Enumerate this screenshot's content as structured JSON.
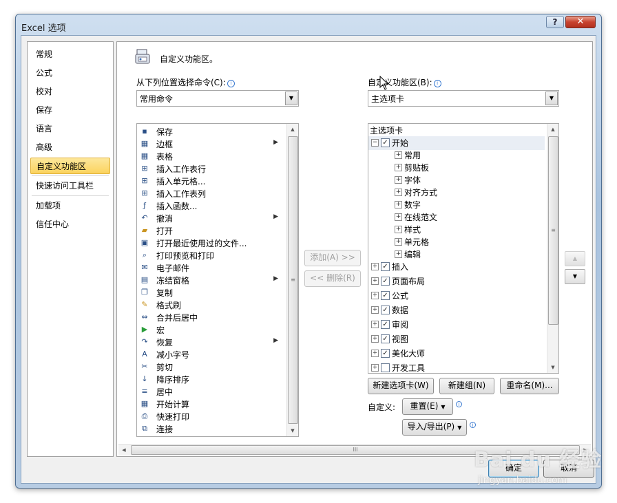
{
  "window": {
    "title": "Excel 选项",
    "help_label": "?",
    "close_label": "✕"
  },
  "nav": {
    "items": [
      {
        "label": "常规"
      },
      {
        "label": "公式"
      },
      {
        "label": "校对"
      },
      {
        "label": "保存"
      },
      {
        "label": "语言"
      },
      {
        "label": "高级"
      },
      {
        "label": "自定义功能区",
        "selected": true
      },
      {
        "label": "快速访问工具栏"
      },
      {
        "label": "加载项"
      },
      {
        "label": "信任中心"
      }
    ]
  },
  "header": {
    "title": "自定义功能区。",
    "icon": "customize-ribbon-icon"
  },
  "left": {
    "label": "从下列位置选择命令(C):",
    "combo_value": "常用命令",
    "commands": [
      {
        "label": "保存",
        "icon": "save-icon"
      },
      {
        "label": "边框",
        "icon": "border-icon",
        "submenu": true
      },
      {
        "label": "表格",
        "icon": "table-icon"
      },
      {
        "label": "插入工作表行",
        "icon": "insert-rows-icon"
      },
      {
        "label": "插入单元格...",
        "icon": "insert-cells-icon"
      },
      {
        "label": "插入工作表列",
        "icon": "insert-columns-icon"
      },
      {
        "label": "插入函数...",
        "icon": "insert-function-icon"
      },
      {
        "label": "撤消",
        "icon": "undo-icon",
        "submenu": true
      },
      {
        "label": "打开",
        "icon": "open-folder-icon"
      },
      {
        "label": "打开最近使用过的文件...",
        "icon": "recent-file-icon"
      },
      {
        "label": "打印预览和打印",
        "icon": "print-preview-icon"
      },
      {
        "label": "电子邮件",
        "icon": "email-icon"
      },
      {
        "label": "冻结窗格",
        "icon": "freeze-panes-icon",
        "submenu": true
      },
      {
        "label": "复制",
        "icon": "copy-icon"
      },
      {
        "label": "格式刷",
        "icon": "format-painter-icon"
      },
      {
        "label": "合并后居中",
        "icon": "merge-center-icon"
      },
      {
        "label": "宏",
        "icon": "macro-icon"
      },
      {
        "label": "恢复",
        "icon": "redo-icon",
        "submenu": true
      },
      {
        "label": "减小字号",
        "icon": "decrease-font-icon"
      },
      {
        "label": "剪切",
        "icon": "cut-icon"
      },
      {
        "label": "降序排序",
        "icon": "sort-descending-icon"
      },
      {
        "label": "居中",
        "icon": "center-align-icon"
      },
      {
        "label": "开始计算",
        "icon": "calculate-icon"
      },
      {
        "label": "快速打印",
        "icon": "quick-print-icon"
      },
      {
        "label": "连接",
        "icon": "connections-icon"
      }
    ]
  },
  "middle": {
    "add_label": "添加(A) >>",
    "remove_label": "<< 删除(R)"
  },
  "right": {
    "label": "自定义功能区(B):",
    "combo_value": "主选项卡",
    "tree_header": "主选项卡",
    "tree": [
      {
        "label": "开始",
        "level": 0,
        "expanded": true,
        "checked": true
      },
      {
        "label": "常用",
        "level": 1
      },
      {
        "label": "剪贴板",
        "level": 1
      },
      {
        "label": "字体",
        "level": 1
      },
      {
        "label": "对齐方式",
        "level": 1
      },
      {
        "label": "数字",
        "level": 1
      },
      {
        "label": "在线范文",
        "level": 1
      },
      {
        "label": "样式",
        "level": 1
      },
      {
        "label": "单元格",
        "level": 1
      },
      {
        "label": "编辑",
        "level": 1
      },
      {
        "label": "插入",
        "level": 0,
        "checked": true
      },
      {
        "label": "页面布局",
        "level": 0,
        "checked": true
      },
      {
        "label": "公式",
        "level": 0,
        "checked": true
      },
      {
        "label": "数据",
        "level": 0,
        "checked": true
      },
      {
        "label": "审阅",
        "level": 0,
        "checked": true
      },
      {
        "label": "视图",
        "level": 0,
        "checked": true
      },
      {
        "label": "美化大师",
        "level": 0,
        "checked": true
      },
      {
        "label": "开发工具",
        "level": 0,
        "checked": false
      }
    ],
    "new_tab_label": "新建选项卡(W)",
    "new_group_label": "新建组(N)",
    "rename_label": "重命名(M)...",
    "customize_label": "自定义:",
    "reset_label": "重置(E)",
    "import_export_label": "导入/导出(P)"
  },
  "footer": {
    "ok_label": "确定",
    "cancel_label": "取消"
  },
  "watermark": {
    "text": "Bai du 经验",
    "url": "jingyan.baidu.com"
  }
}
